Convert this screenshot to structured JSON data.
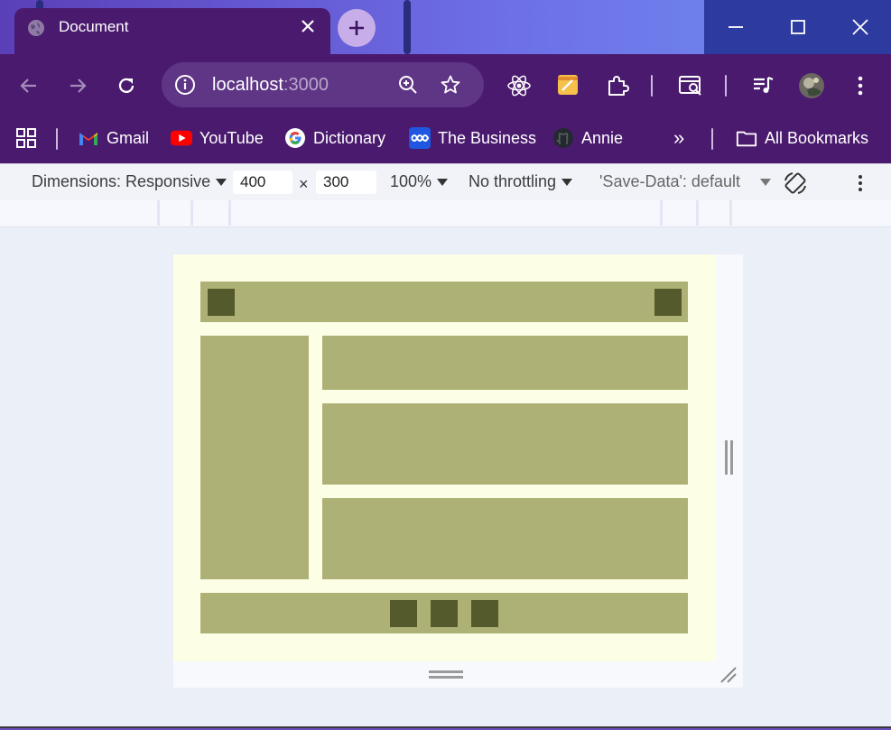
{
  "browser": {
    "tab_title": "Document",
    "new_tab_label": "+",
    "url_host": "localhost",
    "url_port": ":3000",
    "accent_color": "#4a1a6e"
  },
  "bookmarks": [
    {
      "label": "Gmail",
      "icon": "gmail-icon"
    },
    {
      "label": "YouTube",
      "icon": "youtube-icon"
    },
    {
      "label": "Dictionary",
      "icon": "google-icon"
    },
    {
      "label": "The Business",
      "icon": "abc-icon"
    },
    {
      "label": "Annie",
      "icon": "github-icon"
    }
  ],
  "bookmarks_overflow": "»",
  "all_bookmarks_label": "All Bookmarks",
  "devtools": {
    "dimensions_label": "Dimensions: Responsive",
    "width_value": "400",
    "times": "×",
    "height_value": "300",
    "zoom_label": "100%",
    "throttling_label": "No throttling",
    "save_data_label": "'Save-Data': default"
  },
  "page_colors": {
    "background": "#fdfee6",
    "block": "#adb175",
    "square": "#555a2c"
  }
}
